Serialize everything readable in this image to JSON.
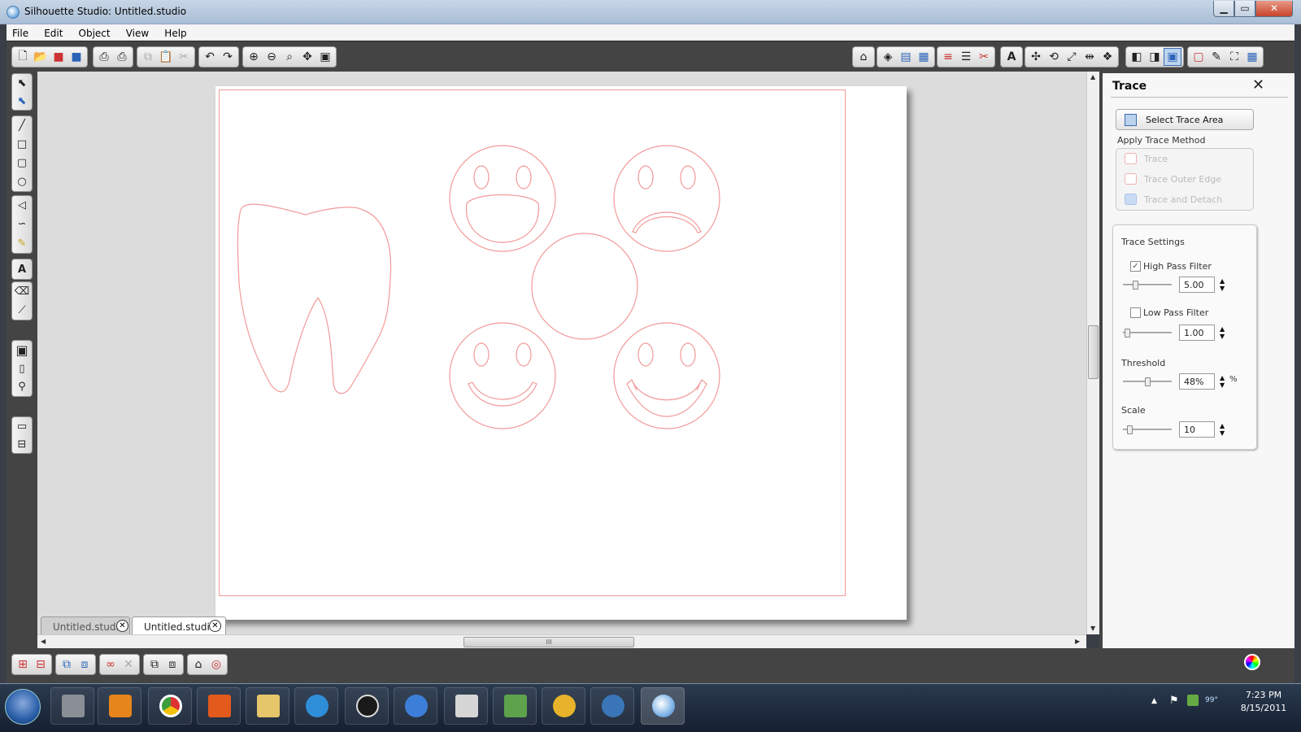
{
  "window": {
    "title": "Silhouette Studio: Untitled.studio"
  },
  "menu": {
    "items": [
      "File",
      "Edit",
      "Object",
      "View",
      "Help"
    ]
  },
  "document_tabs": [
    {
      "label": "Untitled.studio",
      "active": false
    },
    {
      "label": "Untitled.studio",
      "active": true
    }
  ],
  "trace_panel": {
    "title": "Trace",
    "select_area_label": "Select Trace Area",
    "apply_method_label": "Apply Trace Method",
    "methods": [
      "Trace",
      "Trace Outer Edge",
      "Trace and Detach"
    ],
    "settings_label": "Trace Settings",
    "high_pass": {
      "label": "High Pass Filter",
      "checked": true,
      "value": "5.00"
    },
    "low_pass": {
      "label": "Low Pass Filter",
      "checked": false,
      "value": "1.00"
    },
    "threshold": {
      "label": "Threshold",
      "value": "48%",
      "unit": "%"
    },
    "scale": {
      "label": "Scale",
      "value": "10"
    }
  },
  "clock": {
    "time": "7:23 PM",
    "date": "8/15/2011"
  },
  "tray": {
    "temperature": "99°"
  },
  "colors": {
    "cut_line": "#f29a9a",
    "toolbar_bg": "#444444",
    "workspace_bg": "#dcdcdc"
  }
}
